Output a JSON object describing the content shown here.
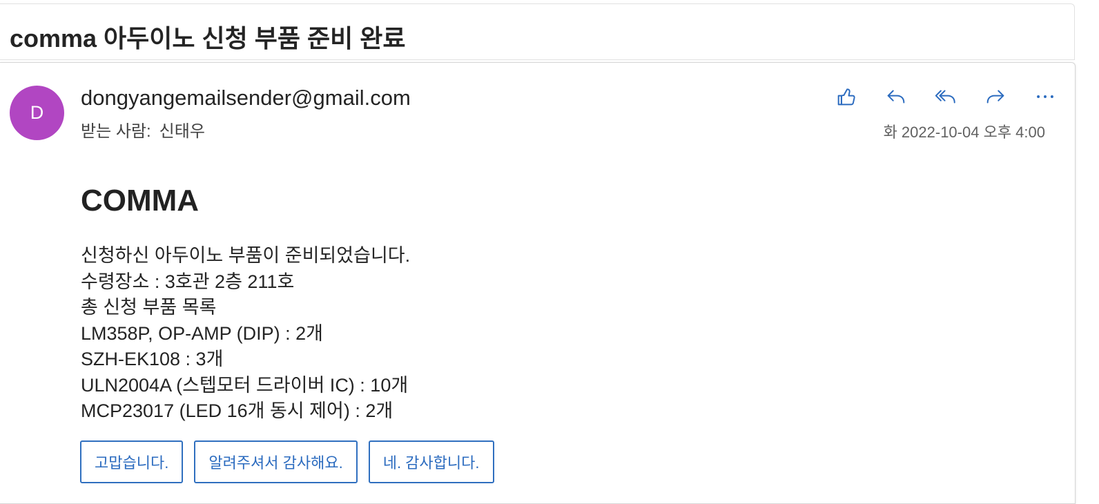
{
  "email": {
    "subject": "comma 아두이노 신청 부품 준비 완료",
    "sender": "dongyangemailsender@gmail.com",
    "avatar_initial": "D",
    "avatar_color": "#b146c2",
    "recipient_label": "받는 사람:",
    "recipient_name": "신태우",
    "timestamp": "화 2022-10-04 오후 4:00",
    "accent_color": "#2b6bbf",
    "actions": [
      {
        "icon": "thumbs-up-icon",
        "name": "like"
      },
      {
        "icon": "reply-icon",
        "name": "reply"
      },
      {
        "icon": "reply-all-icon",
        "name": "reply-all"
      },
      {
        "icon": "forward-icon",
        "name": "forward"
      },
      {
        "icon": "more-icon",
        "name": "more"
      }
    ]
  },
  "body": {
    "heading": "COMMA",
    "lines": [
      "신청하신 아두이노 부품이 준비되었습니다.",
      "수령장소 : 3호관 2층 211호",
      "총 신청 부품 목록",
      "LM358P, OP-AMP (DIP) : 2개",
      "SZH-EK108 : 3개",
      "ULN2004A (스텝모터 드라이버 IC) : 10개",
      "MCP23017 (LED 16개 동시 제어) : 2개"
    ]
  },
  "quick_replies": [
    "고맙습니다.",
    "알려주셔서 감사해요.",
    "네. 감사합니다."
  ]
}
